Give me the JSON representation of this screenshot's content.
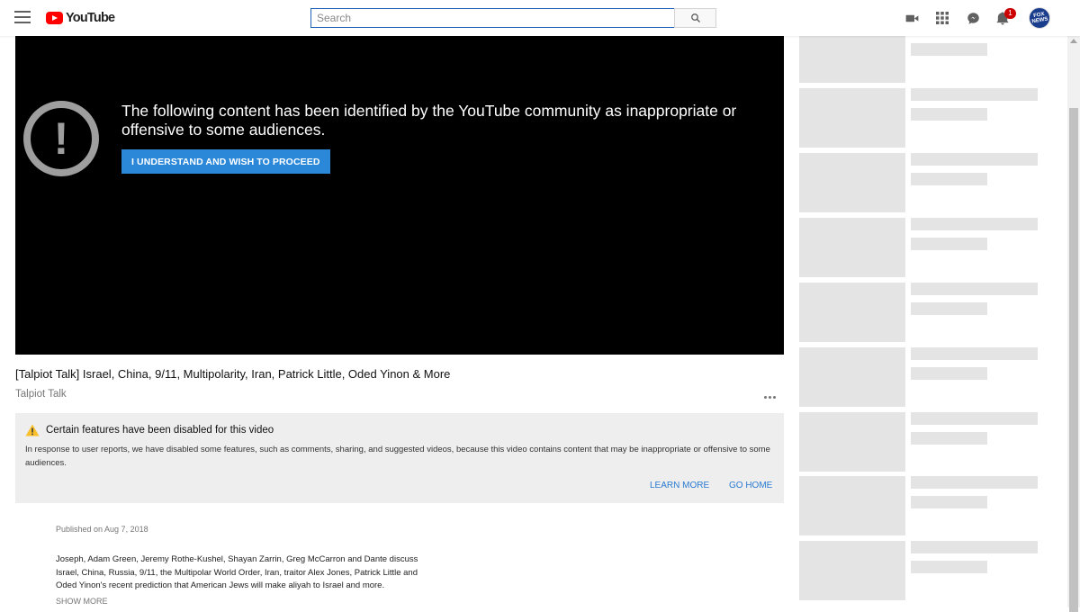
{
  "header": {
    "logo_text": "YouTube",
    "search_placeholder": "Search",
    "notification_count": "1",
    "avatar_text": "FOX NEWS"
  },
  "player": {
    "warning_message": "The following content has been identified by the YouTube community as inappropriate or offensive to some audiences.",
    "proceed_label": "I UNDERSTAND AND WISH TO PROCEED"
  },
  "video": {
    "title": "[Talpiot Talk] Israel, China, 9/11, Multipolarity, Iran, Patrick Little, Oded Yinon & More",
    "channel": "Talpiot Talk"
  },
  "notice": {
    "title": "Certain features have been disabled for this video",
    "body": "In response to user reports, we have disabled some features, such as comments, sharing, and suggested videos, because this video contains content that may be inappropriate or offensive to some audiences.",
    "learn_more_label": "LEARN MORE",
    "go_home_label": "GO HOME"
  },
  "description": {
    "published": "Published on Aug 7, 2018",
    "text": "Joseph, Adam Green, Jeremy Rothe-Kushel, Shayan Zarrin, Greg McCarron and Dante discuss Israel, China, Russia, 9/11, the Multipolar World Order, Iran, traitor Alex Jones, Patrick Little and Oded Yinon's recent prediction that American Jews will make aliyah to Israel and more.",
    "show_more_label": "SHOW MORE"
  },
  "colors": {
    "brand_red": "#ff0000",
    "proceed_button": "#2b88d9",
    "link_blue": "#2a7ad1",
    "warning_yellow": "#f9c02b",
    "placeholder_gray": "#e4e4e4"
  }
}
